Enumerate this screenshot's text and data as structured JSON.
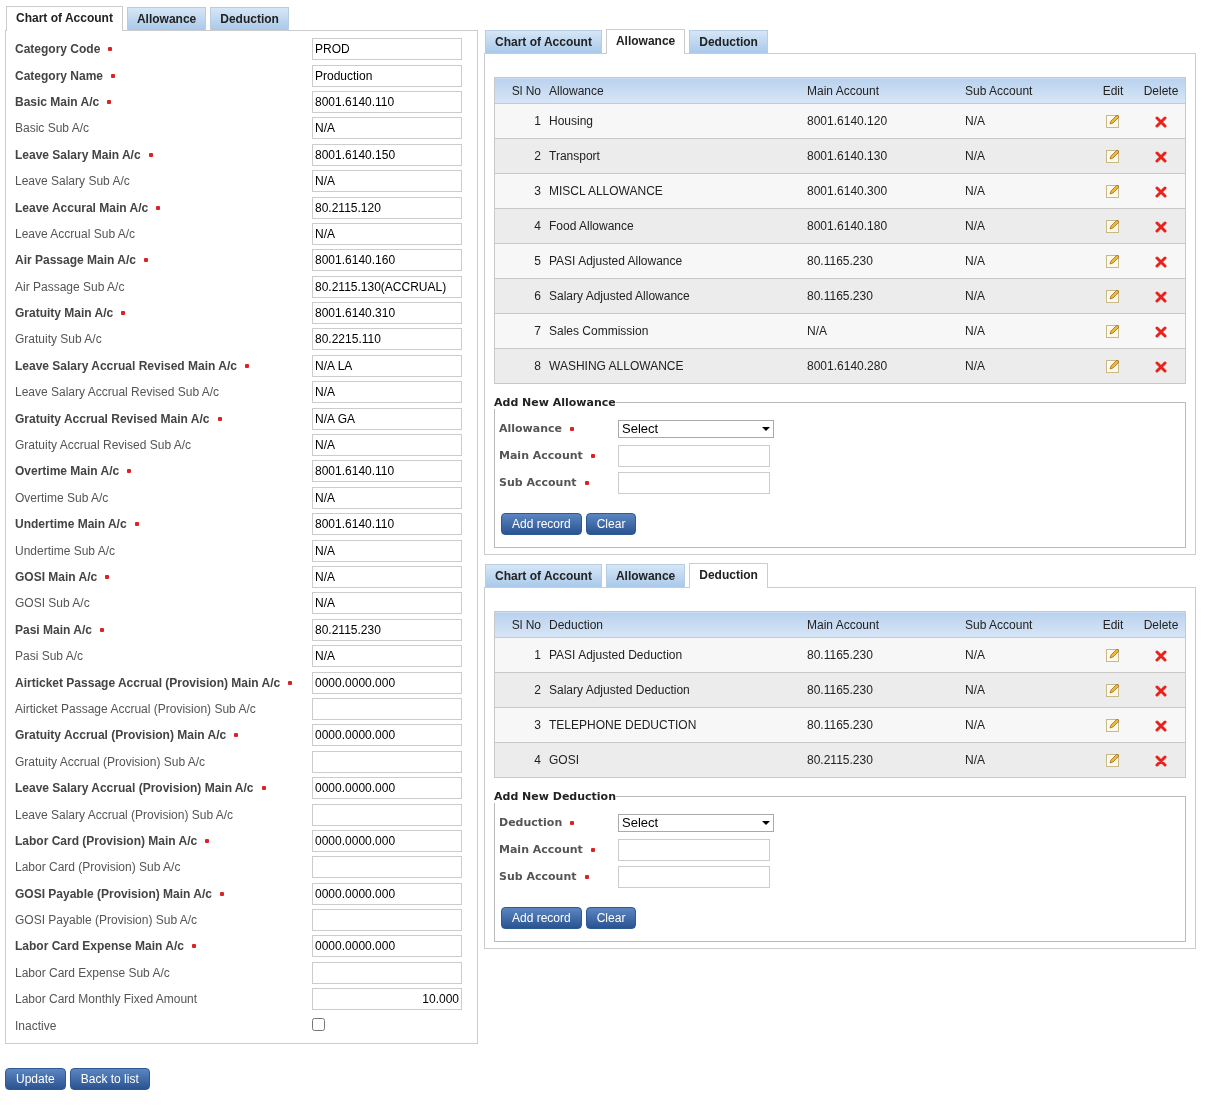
{
  "main_tabs": [
    {
      "label": "Chart of Account",
      "selected": true
    },
    {
      "label": "Allowance",
      "selected": false
    },
    {
      "label": "Deduction",
      "selected": false
    }
  ],
  "fields": [
    {
      "label": "Category Code",
      "required": true,
      "kind": "text",
      "value": "PROD"
    },
    {
      "label": "Category Name",
      "required": true,
      "kind": "text",
      "value": "Production"
    },
    {
      "label": "Basic Main A/c",
      "required": true,
      "kind": "text",
      "value": "8001.6140.110"
    },
    {
      "label": "Basic Sub A/c",
      "required": false,
      "kind": "text",
      "value": "N/A"
    },
    {
      "label": "Leave Salary Main A/c",
      "required": true,
      "kind": "text",
      "value": "8001.6140.150"
    },
    {
      "label": "Leave Salary Sub A/c",
      "required": false,
      "kind": "text",
      "value": "N/A"
    },
    {
      "label": "Leave Accural Main A/c",
      "required": true,
      "kind": "text",
      "value": "80.2115.120"
    },
    {
      "label": "Leave Accrual Sub A/c",
      "required": false,
      "kind": "text",
      "value": "N/A"
    },
    {
      "label": "Air Passage Main A/c",
      "required": true,
      "kind": "text",
      "value": "8001.6140.160"
    },
    {
      "label": "Air Passage Sub A/c",
      "required": false,
      "kind": "text",
      "value": "80.2115.130(ACCRUAL)"
    },
    {
      "label": "Gratuity Main A/c",
      "required": true,
      "kind": "text",
      "value": "8001.6140.310"
    },
    {
      "label": "Gratuity Sub A/c",
      "required": false,
      "kind": "text",
      "value": "80.2215.110"
    },
    {
      "label": "Leave Salary Accrual Revised Main A/c",
      "required": true,
      "kind": "text",
      "value": "N/A LA"
    },
    {
      "label": "Leave Salary Accrual Revised Sub A/c",
      "required": false,
      "kind": "text",
      "value": "N/A"
    },
    {
      "label": "Gratuity Accrual Revised Main A/c",
      "required": true,
      "kind": "text",
      "value": "N/A GA"
    },
    {
      "label": "Gratuity Accrual Revised Sub A/c",
      "required": false,
      "kind": "text",
      "value": "N/A"
    },
    {
      "label": "Overtime Main A/c",
      "required": true,
      "kind": "text",
      "value": "8001.6140.110"
    },
    {
      "label": "Overtime Sub A/c",
      "required": false,
      "kind": "text",
      "value": "N/A"
    },
    {
      "label": "Undertime Main A/c",
      "required": true,
      "kind": "text",
      "value": "8001.6140.110"
    },
    {
      "label": "Undertime Sub A/c",
      "required": false,
      "kind": "text",
      "value": "N/A"
    },
    {
      "label": "GOSI Main A/c",
      "required": true,
      "kind": "text",
      "value": "N/A"
    },
    {
      "label": "GOSI Sub A/c",
      "required": false,
      "kind": "text",
      "value": "N/A"
    },
    {
      "label": "Pasi Main A/c",
      "required": true,
      "kind": "text",
      "value": "80.2115.230"
    },
    {
      "label": "Pasi Sub A/c",
      "required": false,
      "kind": "text",
      "value": "N/A"
    },
    {
      "label": "Airticket Passage Accrual (Provision) Main A/c",
      "required": true,
      "kind": "text",
      "value": "0000.0000.000"
    },
    {
      "label": "Airticket Passage Accrual (Provision) Sub A/c",
      "required": false,
      "kind": "text"
    },
    {
      "label": "Gratuity Accrual (Provision) Main A/c",
      "required": true,
      "kind": "text",
      "value": "0000.0000.000"
    },
    {
      "label": "Gratuity Accrual (Provision) Sub A/c",
      "required": false,
      "kind": "text"
    },
    {
      "label": "Leave Salary Accrual (Provision) Main A/c",
      "required": true,
      "kind": "text",
      "value": "0000.0000.000"
    },
    {
      "label": "Leave Salary Accrual (Provision) Sub A/c",
      "required": false,
      "kind": "text"
    },
    {
      "label": "Labor Card (Provision) Main A/c",
      "required": true,
      "kind": "text",
      "value": "0000.0000.000"
    },
    {
      "label": "Labor Card (Provision) Sub A/c",
      "required": false,
      "kind": "text"
    },
    {
      "label": "GOSI Payable (Provision) Main A/c",
      "required": true,
      "kind": "text",
      "value": "0000.0000.000"
    },
    {
      "label": "GOSI Payable (Provision) Sub A/c",
      "required": false,
      "kind": "text"
    },
    {
      "label": "Labor Card Expense Main A/c",
      "required": true,
      "kind": "text",
      "value": "0000.0000.000"
    },
    {
      "label": "Labor Card Expense Sub A/c",
      "required": false,
      "kind": "text"
    },
    {
      "label": "Labor Card Monthly Fixed Amount",
      "required": false,
      "kind": "amount",
      "value": "10.000"
    },
    {
      "label": "Inactive",
      "required": false,
      "kind": "checkbox",
      "checked": false
    }
  ],
  "buttons": [
    "Update",
    "Back to list"
  ],
  "panels": [
    {
      "tabs": [
        {
          "label": "Chart of Account",
          "selected": false
        },
        {
          "label": "Allowance",
          "selected": true
        },
        {
          "label": "Deduction",
          "selected": false
        }
      ],
      "columns": [
        "Sl No",
        "Allowance",
        "Main Account",
        "Sub Account",
        "Edit",
        "Delete"
      ],
      "rows": [
        {
          "no": "1",
          "name": "Housing",
          "main": "8001.6140.120",
          "sub": "N/A"
        },
        {
          "no": "2",
          "name": "Transport",
          "main": "8001.6140.130",
          "sub": "N/A"
        },
        {
          "no": "3",
          "name": "MISCL ALLOWANCE",
          "main": "8001.6140.300",
          "sub": "N/A"
        },
        {
          "no": "4",
          "name": "Food Allowance",
          "main": "8001.6140.180",
          "sub": "N/A"
        },
        {
          "no": "5",
          "name": "PASI Adjusted Allowance",
          "main": "80.1165.230",
          "sub": "N/A"
        },
        {
          "no": "6",
          "name": "Salary Adjusted Allowance",
          "main": "80.1165.230",
          "sub": "N/A"
        },
        {
          "no": "7",
          "name": "Sales Commission",
          "main": "N/A",
          "sub": "N/A"
        },
        {
          "no": "8",
          "name": "WASHING ALLOWANCE",
          "main": "8001.6140.280",
          "sub": "N/A"
        }
      ],
      "form": {
        "legend": "Add New Allowance",
        "select_label": "Allowance",
        "select_value": "Select",
        "main_label": "Main Account",
        "sub_label": "Sub Account",
        "buttons": [
          "Add record",
          "Clear"
        ]
      }
    },
    {
      "tabs": [
        {
          "label": "Chart of Account",
          "selected": false
        },
        {
          "label": "Allowance",
          "selected": false
        },
        {
          "label": "Deduction",
          "selected": true
        }
      ],
      "columns": [
        "Sl No",
        "Deduction",
        "Main Account",
        "Sub Account",
        "Edit",
        "Delete"
      ],
      "rows": [
        {
          "no": "1",
          "name": "PASI Adjusted Deduction",
          "main": "80.1165.230",
          "sub": "N/A"
        },
        {
          "no": "2",
          "name": "Salary Adjusted Deduction",
          "main": "80.1165.230",
          "sub": "N/A"
        },
        {
          "no": "3",
          "name": "TELEPHONE DEDUCTION",
          "main": "80.1165.230",
          "sub": "N/A"
        },
        {
          "no": "4",
          "name": "GOSI",
          "main": "80.2115.230",
          "sub": "N/A"
        }
      ],
      "form": {
        "legend": "Add New Deduction",
        "select_label": "Deduction",
        "select_value": "Select",
        "main_label": "Main Account",
        "sub_label": "Sub Account",
        "buttons": [
          "Add record",
          "Clear"
        ]
      }
    }
  ]
}
